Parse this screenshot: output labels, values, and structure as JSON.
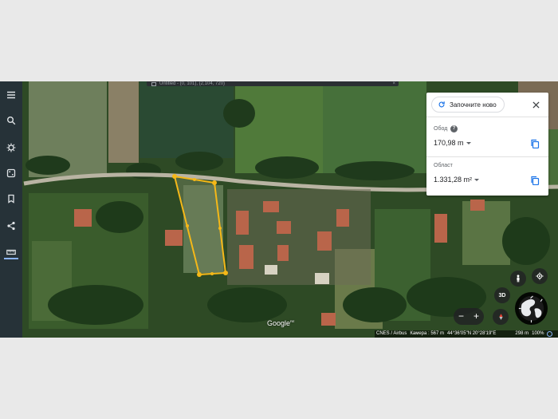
{
  "window": {
    "title": "Untitled - (0, 101), (2,104, 720)"
  },
  "toolbar": {
    "items": [
      {
        "name": "menu-icon",
        "active": false
      },
      {
        "name": "search-icon",
        "active": false
      },
      {
        "name": "voyager-icon",
        "active": false
      },
      {
        "name": "feeling-lucky-icon",
        "active": false
      },
      {
        "name": "projects-icon",
        "active": false
      },
      {
        "name": "share-icon",
        "active": false
      },
      {
        "name": "measure-icon",
        "active": true
      }
    ]
  },
  "measure_panel": {
    "restart_label": "Започните ново",
    "perimeter_label": "Обод",
    "perimeter_value": "170,98 m",
    "area_label": "Област",
    "area_value": "1.331,28 m²"
  },
  "map_controls": {
    "view_3d_label": "3D",
    "zoom_out_label": "−",
    "zoom_in_label": "+",
    "logo": "Google",
    "logo_suffix": "RE"
  },
  "status_bar": {
    "attribution": "CNES / Airbus",
    "camera": "Камера : 567 m",
    "coordinates": "44°36'05\"N 20°28'19\"E",
    "elevation": "298 m",
    "zoom": "100%"
  },
  "colors": {
    "measure_line": "#f5b818",
    "toolbar_bg": "#263238",
    "accent": "#1a73e8"
  }
}
